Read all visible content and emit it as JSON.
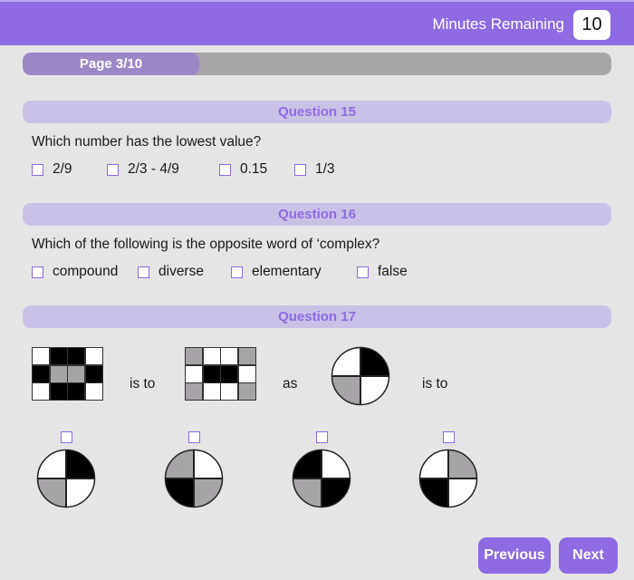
{
  "header": {
    "timer_label": "Minutes Remaining",
    "timer_value": "10",
    "brand_color": "#8e6be3"
  },
  "progress": {
    "label": "Page 3/10",
    "current_page": 3,
    "total_pages": 10,
    "fraction": 0.3
  },
  "questions": [
    {
      "title": "Question 15",
      "text": "Which number has the lowest value?",
      "options": [
        "2/9",
        "2/3 - 4/9",
        "0.15",
        "1/3"
      ]
    },
    {
      "title": "Question 16",
      "text": "Which of the following is the opposite word of ‘complex?",
      "options": [
        "compound",
        "diverse",
        "elementary",
        "false"
      ]
    },
    {
      "title": "Question 17",
      "analogy_words": [
        "is to",
        "as",
        "is to"
      ],
      "grid_a": [
        [
          "w",
          "b",
          "b",
          "w"
        ],
        [
          "b",
          "g",
          "g",
          "b"
        ],
        [
          "w",
          "b",
          "b",
          "w"
        ]
      ],
      "grid_b": [
        [
          "g",
          "w",
          "w",
          "g"
        ],
        [
          "w",
          "b",
          "b",
          "w"
        ],
        [
          "g",
          "w",
          "w",
          "g"
        ]
      ],
      "circle_c": {
        "tl": "w",
        "tr": "b",
        "bl": "g",
        "br": "w"
      },
      "circle_options": [
        {
          "tl": "w",
          "tr": "b",
          "bl": "g",
          "br": "w"
        },
        {
          "tl": "g",
          "tr": "w",
          "bl": "b",
          "br": "g"
        },
        {
          "tl": "b",
          "tr": "w",
          "bl": "g",
          "br": "b"
        },
        {
          "tl": "w",
          "tr": "g",
          "bl": "b",
          "br": "w"
        }
      ]
    }
  ],
  "nav": {
    "previous_label": "Previous",
    "next_label": "Next"
  }
}
